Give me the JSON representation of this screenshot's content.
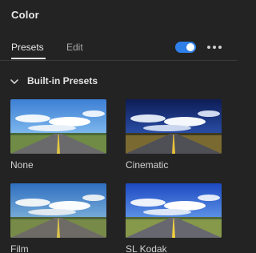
{
  "panel": {
    "title": "Color"
  },
  "tabs": [
    {
      "label": "Presets",
      "active": true
    },
    {
      "label": "Edit",
      "active": false
    }
  ],
  "toggle": {
    "state": "on",
    "color": "#2f7fe8"
  },
  "more_icon": "more-horizontal-icon",
  "section": {
    "label": "Built-in Presets",
    "expanded": true,
    "icon": "chevron-down-icon"
  },
  "presets": [
    {
      "label": "None"
    },
    {
      "label": "Cinematic"
    },
    {
      "label": "Film"
    },
    {
      "label": "SL Kodak"
    }
  ]
}
